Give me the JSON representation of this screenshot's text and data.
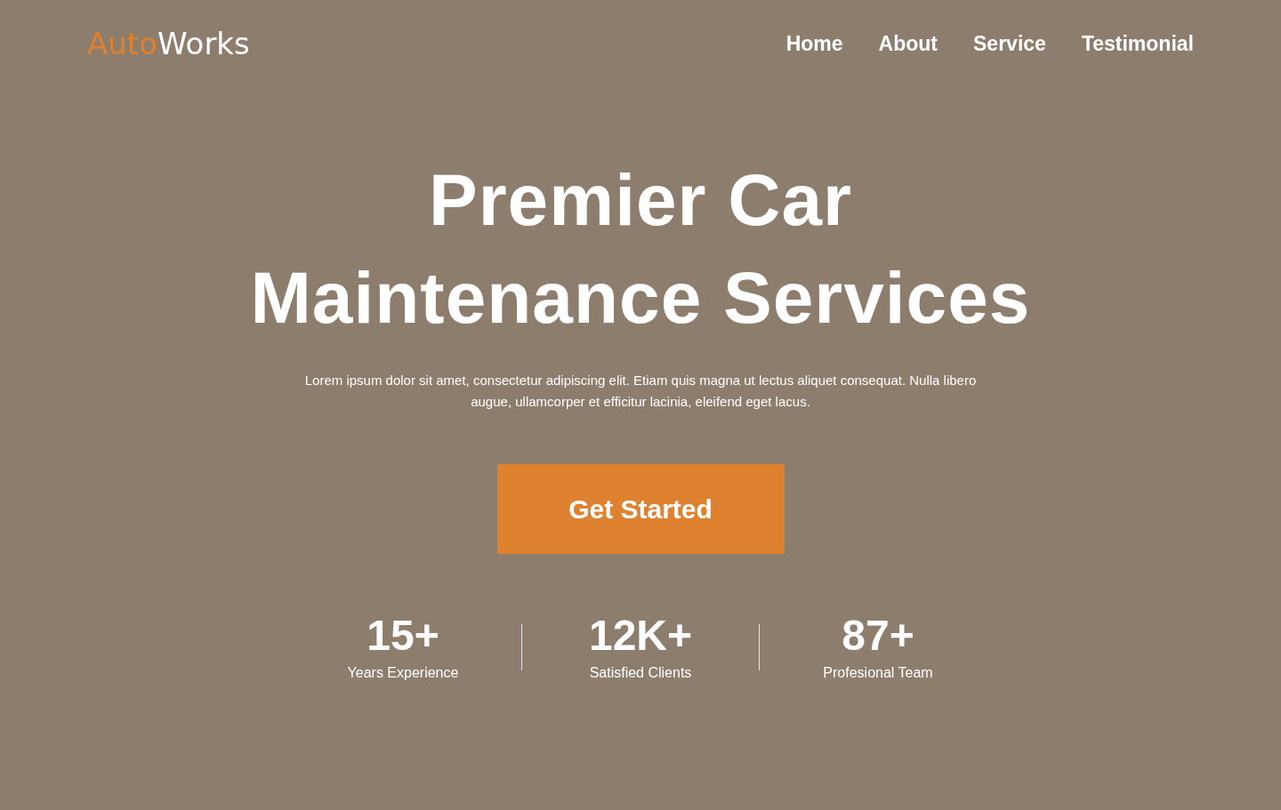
{
  "logo": {
    "accent": "Auto",
    "rest": "Works"
  },
  "nav": [
    {
      "label": "Home"
    },
    {
      "label": "About"
    },
    {
      "label": "Service"
    },
    {
      "label": "Testimonial"
    }
  ],
  "hero": {
    "title_lines": [
      "Premier Car",
      "Maintenance Services"
    ],
    "description": "Lorem ipsum dolor sit amet, consectetur adipiscing elit. Etiam quis magna ut lectus aliquet consequat. Nulla libero augue, ullamcorper et efficitur lacinia, eleifend eget lacus.",
    "button": "Get Started"
  },
  "stats": [
    {
      "value": "15+",
      "label": "Years Experience"
    },
    {
      "value": "12K+",
      "label": "Satisfied Clients"
    },
    {
      "value": "87+",
      "label": "Profesional Team"
    }
  ]
}
